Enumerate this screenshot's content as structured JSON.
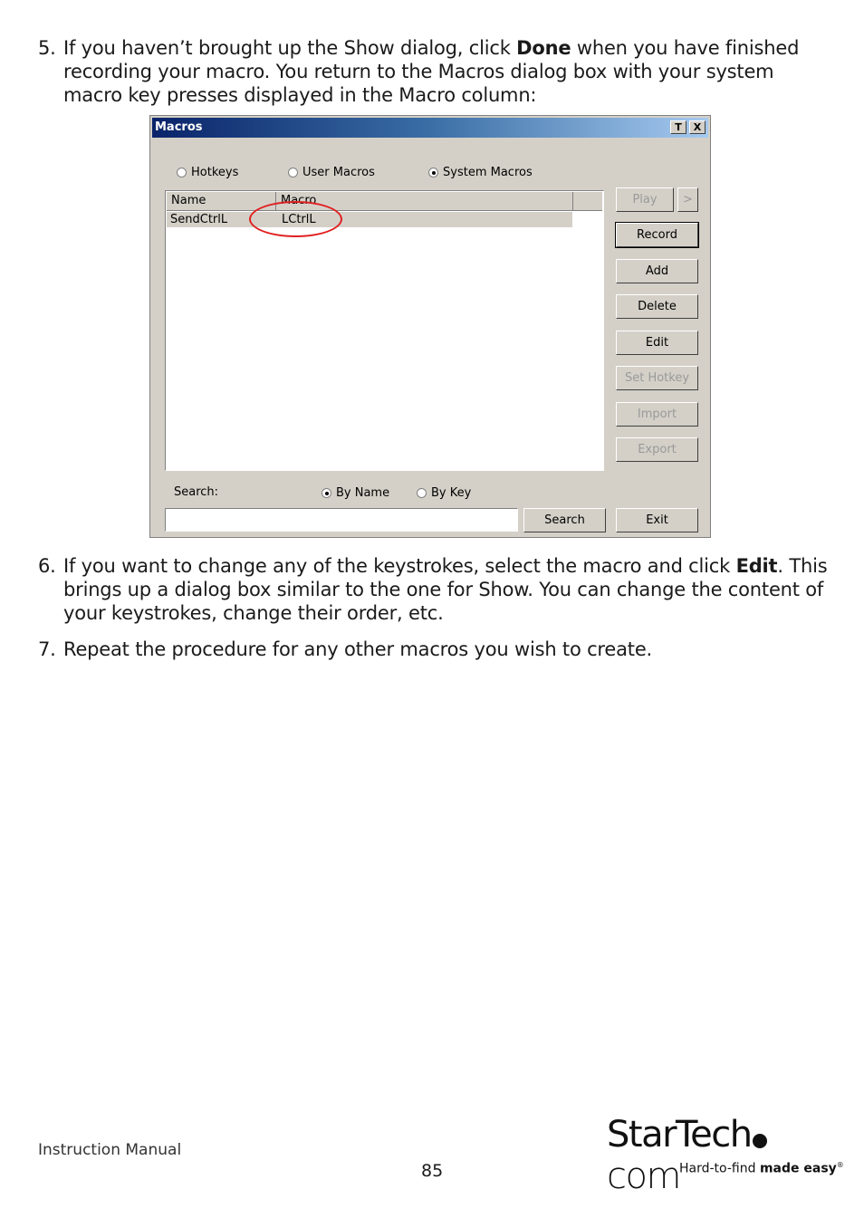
{
  "steps": [
    {
      "num": "5.",
      "pre": "If you haven’t brought up the Show dialog, click ",
      "bold": "Done",
      "post": " when you have  finished recording your macro. You return to the Macros dialog box with  your system macro key presses displayed in the Macro column:"
    },
    {
      "num": "6.",
      "pre": "If you want to change any of the keystrokes, select the macro and click ",
      "bold": "Edit",
      "post": ". This brings up a dialog box similar to the one for Show. You can  change the content of your keystrokes, change their order, etc."
    },
    {
      "num": "7.",
      "pre": "Repeat the procedure for any other macros you wish to create.",
      "bold": "",
      "post": ""
    }
  ],
  "dialog": {
    "title": "Macros",
    "title_buttons": [
      "T",
      "X"
    ],
    "radios": [
      {
        "label": "Hotkeys",
        "checked": false
      },
      {
        "label": "User Macros",
        "checked": false
      },
      {
        "label": "System Macros",
        "checked": true
      }
    ],
    "columns": [
      "Name",
      "Macro"
    ],
    "rows": [
      {
        "name": "SendCtrlL",
        "macro": "LCtrlL"
      }
    ],
    "buttons": {
      "play": "Play",
      "play_more": ">",
      "record": "Record",
      "add": "Add",
      "delete": "Delete",
      "edit": "Edit",
      "set_hotkey": "Set Hotkey",
      "import": "Import",
      "export": "Export"
    },
    "search_label": "Search:",
    "search_radios": [
      {
        "label": "By Name",
        "checked": true
      },
      {
        "label": "By Key",
        "checked": false
      }
    ],
    "search_value": "",
    "search_button": "Search",
    "exit_button": "Exit",
    "highlight_color": "#e02020"
  },
  "footer": {
    "left": "Instruction Manual",
    "page": "85",
    "logo_word_1": "StarTech",
    "logo_word_2": "com",
    "logo_tagline_1": "Hard-to-find ",
    "logo_tagline_2": "made easy",
    "logo_reg": "®"
  }
}
